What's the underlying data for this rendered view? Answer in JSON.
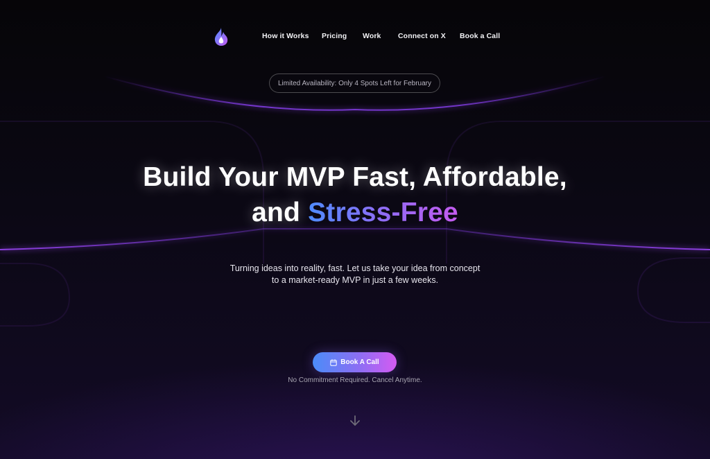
{
  "nav": {
    "logo_icon": "flame-logo-icon",
    "links": [
      "How it Works",
      "Pricing",
      "Work",
      "Connect on X",
      "Book a Call"
    ]
  },
  "banner": {
    "text": "Limited Availability: Only 4 Spots Left for February"
  },
  "hero": {
    "line1": "Build Your MVP Fast, Affordable,",
    "line2_prefix": "and",
    "line2_highlight": "Stress-Free"
  },
  "subtitle": {
    "line1": "Turning ideas into reality, fast. Let us take your idea from concept",
    "line2": "to a market-ready MVP in just a few weeks."
  },
  "cta": {
    "icon": "calendar-icon",
    "label": "Book A Call",
    "note": "No Commitment Required. Cancel Anytime."
  },
  "scroll": {
    "icon": "arrow-down-icon"
  },
  "colors": {
    "background": "#07060b",
    "accent_blue": "#4e8cff",
    "accent_purple": "#c45bf0",
    "glow_purple": "#8a3ff0"
  }
}
